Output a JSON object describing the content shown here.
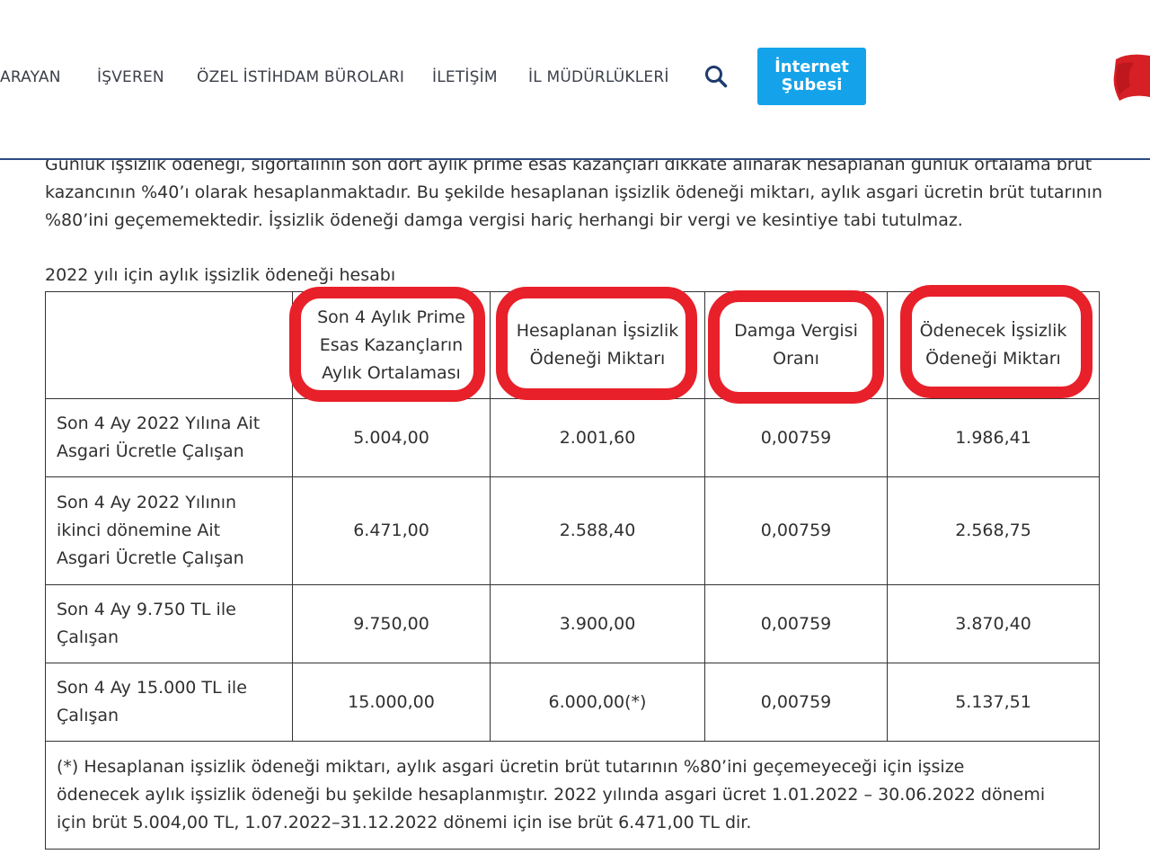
{
  "nav": {
    "items": [
      "ARAYAN",
      "İŞVEREN",
      "ÖZEL İSTİHDAM BÜROLARI",
      "İLETİŞİM",
      "İL MÜDÜRLÜKLERİ"
    ],
    "internet_line1": "İnternet",
    "internet_line2": "Şubesi",
    "search_icon": "search-icon",
    "accent": "#14a3ea"
  },
  "intro": {
    "line1": "Günlük işsizlik ödeneği, sigortalının son dört aylık prime esas kazançları dikkate alınarak hesaplanan günlük ortalama brüt",
    "line2": "kazancının %40’ı olarak hesaplanmaktadır. Bu şekilde hesaplanan işsizlik ödeneği miktarı, aylık asgari ücretin brüt tutarının",
    "line3": "%80’ini geçememektedir. İşsizlik ödeneği damga vergisi hariç herhangi bir vergi ve kesintiye tabi tutulmaz."
  },
  "table": {
    "caption": "2022 yılı için aylık işsizlik ödeneği hesabı",
    "headers": [
      [
        "Son 4 Aylık Prime",
        "Esas Kazançların",
        "Aylık Ortalaması"
      ],
      [
        "Hesaplanan İşsizlik",
        "Ödeneği Miktarı"
      ],
      [
        "Damga Vergisi",
        "Oranı"
      ],
      [
        "Ödenecek İşsizlik",
        "Ödeneği Miktarı"
      ]
    ],
    "rows": [
      {
        "label": [
          "Son 4 Ay 2022 Yılına Ait",
          "Asgari Ücretle Çalışan"
        ],
        "values": [
          "5.004,00",
          "2.001,60",
          "0,00759",
          "1.986,41"
        ]
      },
      {
        "label": [
          "Son 4 Ay 2022 Yılının",
          "ikinci dönemine Ait",
          "Asgari Ücretle Çalışan"
        ],
        "values": [
          "6.471,00",
          "2.588,40",
          "0,00759",
          "2.568,75"
        ]
      },
      {
        "label": [
          "Son 4 Ay 9.750 TL ile",
          "Çalışan"
        ],
        "values": [
          "9.750,00",
          "3.900,00",
          "0,00759",
          "3.870,40"
        ]
      },
      {
        "label": [
          "Son 4 Ay 15.000 TL ile",
          "Çalışan"
        ],
        "values": [
          "15.000,00",
          "6.000,00(*)",
          "0,00759",
          "5.137,51"
        ]
      }
    ],
    "note": [
      "(*)  Hesaplanan işsizlik ödeneği miktarı, aylık asgari ücretin brüt tutarının %80’ini geçemeyeceği için işsize",
      "ödenecek aylık işsizlik ödeneği bu şekilde hesaplanmıştır. 2022 yılında asgari ücret 1.01.2022 – 30.06.2022 dönemi",
      "için brüt 5.004,00 TL,  1.07.2022–31.12.2022 dönemi için ise brüt 6.471,00 TL dir."
    ],
    "highlight_color": "#e8202a"
  }
}
